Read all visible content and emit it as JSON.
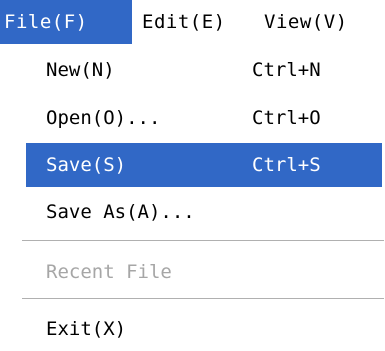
{
  "menubar": {
    "items": [
      {
        "label": "File(F)",
        "selected": true
      },
      {
        "label": "Edit(E)",
        "selected": false
      },
      {
        "label": "View(V)",
        "selected": false
      }
    ]
  },
  "file_menu": {
    "items": [
      {
        "label": "New(N)",
        "shortcut": "Ctrl+N",
        "state": "normal"
      },
      {
        "label": "Open(O)...",
        "shortcut": "Ctrl+O",
        "state": "normal"
      },
      {
        "label": "Save(S)",
        "shortcut": "Ctrl+S",
        "state": "highlighted"
      },
      {
        "label": "Save As(A)...",
        "shortcut": "",
        "state": "normal"
      },
      {
        "label": "Recent File",
        "shortcut": "",
        "state": "disabled"
      },
      {
        "label": "Exit(X)",
        "shortcut": "",
        "state": "normal"
      }
    ]
  },
  "colors": {
    "highlight": "#3168c6",
    "highlight_text": "#ffffff",
    "disabled_text": "#a6a6a6",
    "separator": "#b0b0b0"
  }
}
